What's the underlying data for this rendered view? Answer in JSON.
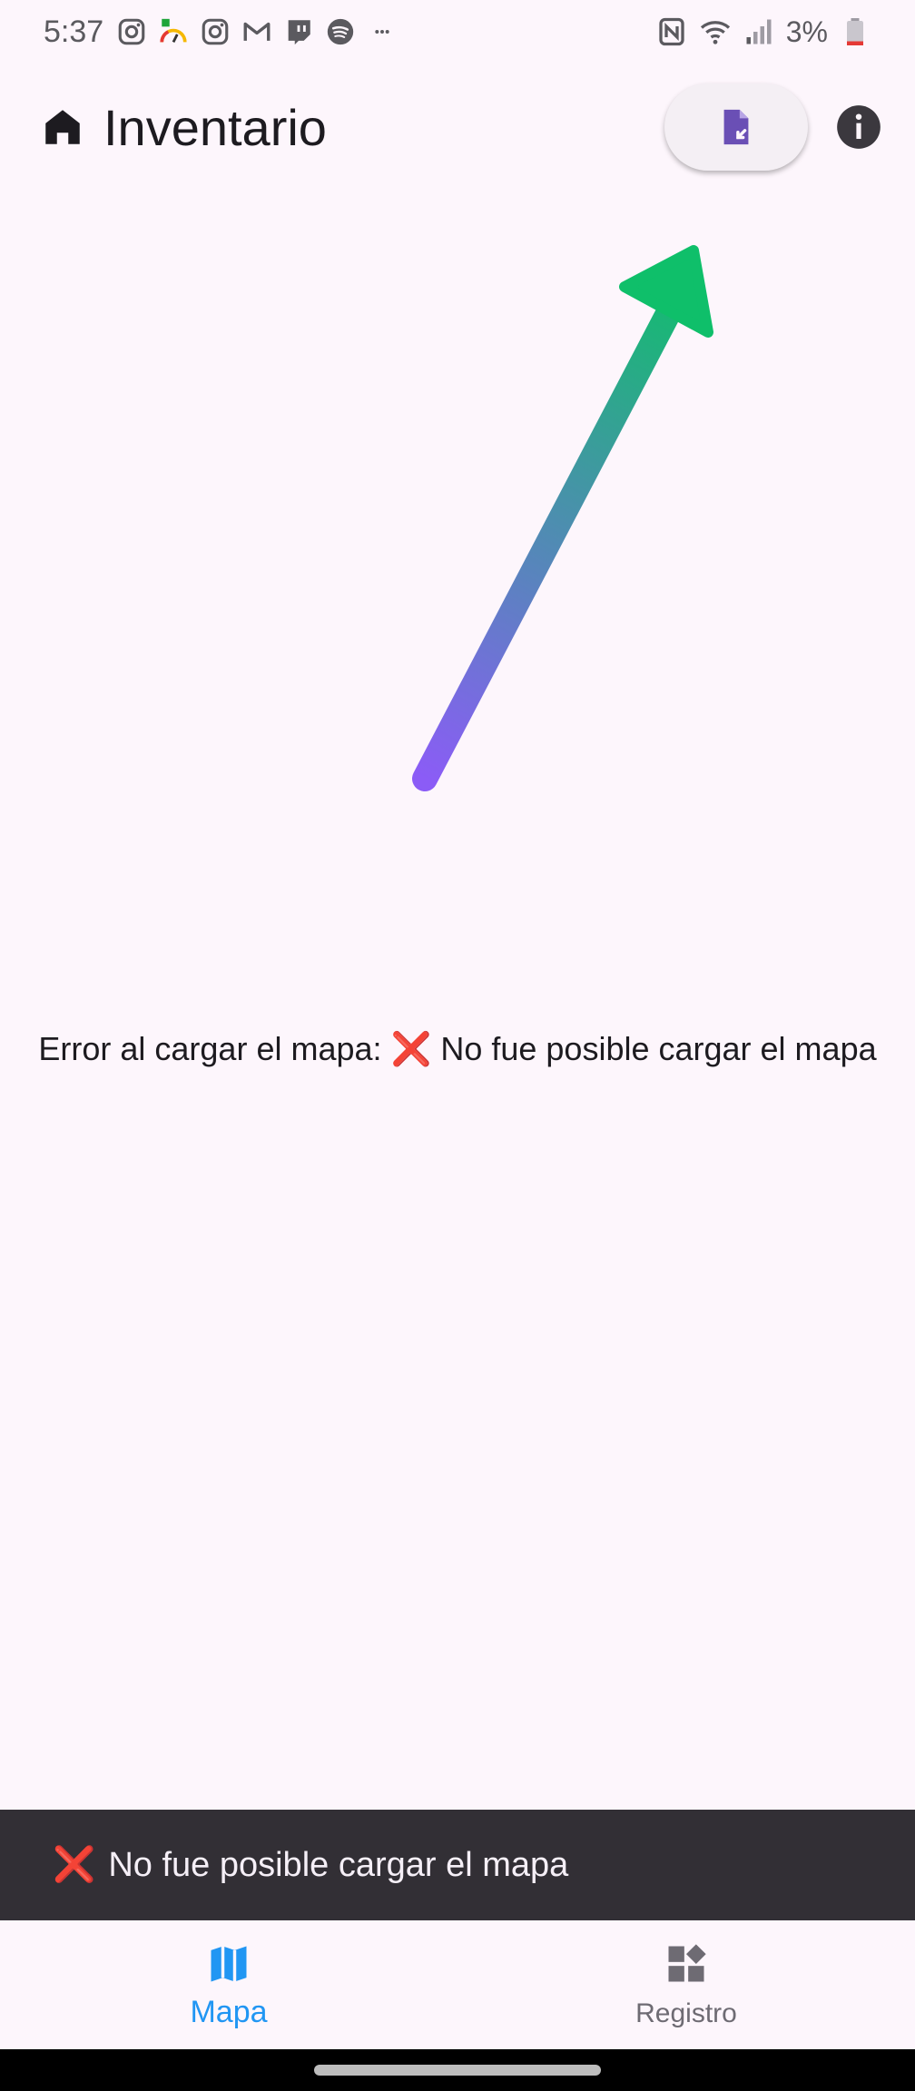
{
  "status_bar": {
    "time": "5:37",
    "battery": "3%",
    "icons": [
      "instagram-icon",
      "app-gauge-icon",
      "instagram-icon",
      "gmail-icon",
      "twitch-icon",
      "spotify-icon",
      "more-dots-icon"
    ],
    "right_icons": [
      "nfc-icon",
      "wifi-icon",
      "signal-icon",
      "battery-icon"
    ]
  },
  "appbar": {
    "title": "Inventario",
    "home_icon": "home-icon",
    "import_icon": "file-import-icon",
    "info_icon": "info-icon"
  },
  "main": {
    "error_message": "Error al cargar el mapa: ❌ No fue posible cargar el mapa"
  },
  "snackbar": {
    "icon": "❌",
    "message": "No fue posible cargar el mapa"
  },
  "bottom_nav": {
    "items": [
      {
        "label": "Mapa",
        "icon": "map-icon",
        "active": true
      },
      {
        "label": "Registro",
        "icon": "widgets-icon",
        "active": false
      }
    ]
  },
  "colors": {
    "background": "#fdf6fc",
    "accent": "#2196f3",
    "import_icon": "#6a4fb5",
    "snackbar_bg": "#322f35",
    "arrow_start": "#8b5cf6",
    "arrow_end": "#0fbf6a"
  }
}
